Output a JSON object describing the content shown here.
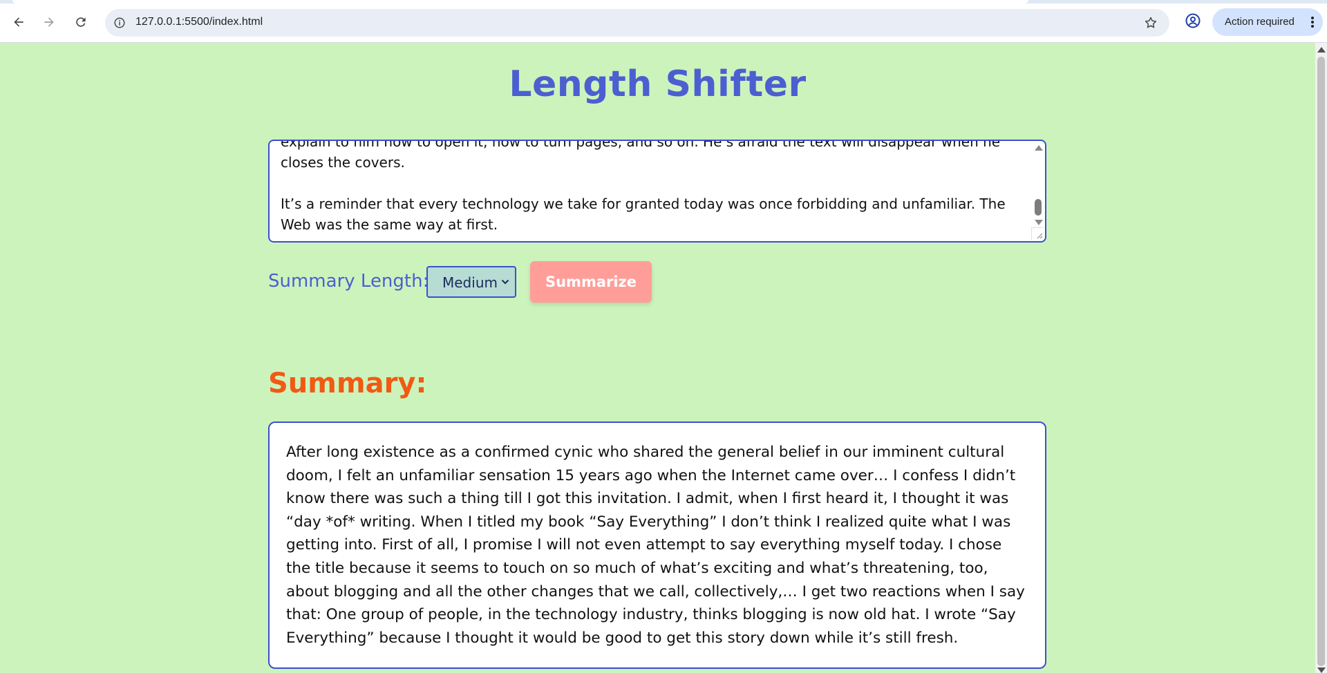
{
  "browser": {
    "url": "127.0.0.1:5500/index.html",
    "action_label": "Action required",
    "icons": {
      "back": "arrow-left-icon",
      "forward": "arrow-right-icon",
      "reload": "reload-icon",
      "site_info": "info-icon",
      "bookmark": "star-icon",
      "profile": "account-circle-icon",
      "menu": "kebab-menu-icon"
    }
  },
  "page": {
    "title": "Length Shifter",
    "input_text": "explain to him how to open it, how to turn pages, and so on. He’s afraid the text will disappear when he closes the covers.\n\nIt’s a reminder that every technology we take for granted today was once forbidding and unfamiliar. The Web was the same way at first.",
    "summary_length_label": "Summary Length:",
    "summary_length_value": "Medium",
    "summarize_button": "Summarize",
    "summary_heading": "Summary:",
    "summary_text": "After long existence as a confirmed cynic who shared the general belief in our imminent cultural doom, I felt an unfamiliar sensation 15 years ago when the Internet came over… I confess I didn’t know there was such a thing till I got this invitation. I admit, when I first heard it, I thought it was “day *of* writing. When I titled my book “Say Everything” I don’t think I realized quite what I was getting into. First of all, I promise I will not even attempt to say everything myself today. I chose the title because it seems to touch on so much of what’s exciting and what’s threatening, too, about blogging and all the other changes that we call, collectively,… I get two reactions when I say that: One group of people, in the technology industry, thinks blogging is now old hat. I wrote “Say Everything” because I thought it would be good to get this story down while it’s still fresh."
  },
  "colors": {
    "background": "#cdf3bc",
    "title": "#4b5fd1",
    "border": "#3a4fcf",
    "summary_heading": "#f05a14",
    "button": "#ff9e99",
    "select_bg": "#b6dcd3"
  }
}
